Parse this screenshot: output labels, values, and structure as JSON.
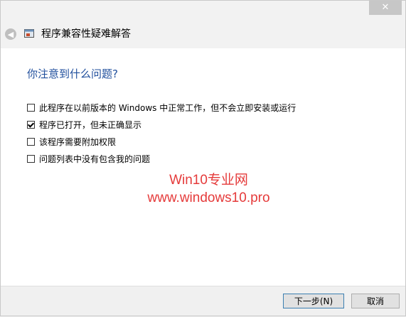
{
  "window": {
    "close_symbol": "✕"
  },
  "header": {
    "title": "程序兼容性疑难解答"
  },
  "main": {
    "heading": "你注意到什么问题?",
    "options": [
      {
        "label": "此程序在以前版本的 Windows 中正常工作，但不会立即安装或运行",
        "checked": false
      },
      {
        "label": "程序已打开，但未正确显示",
        "checked": true
      },
      {
        "label": "该程序需要附加权限",
        "checked": false
      },
      {
        "label": "问题列表中没有包含我的问题",
        "checked": false
      }
    ]
  },
  "watermark": {
    "line1": "Win10专业网",
    "line2": "www.windows10.pro",
    "color": "#e53a3a"
  },
  "footer": {
    "next_label": "下一步(N)",
    "cancel_label": "取消"
  },
  "icons": {
    "back": "arrow-left-icon",
    "app": "wizard-icon",
    "close": "close-icon"
  }
}
